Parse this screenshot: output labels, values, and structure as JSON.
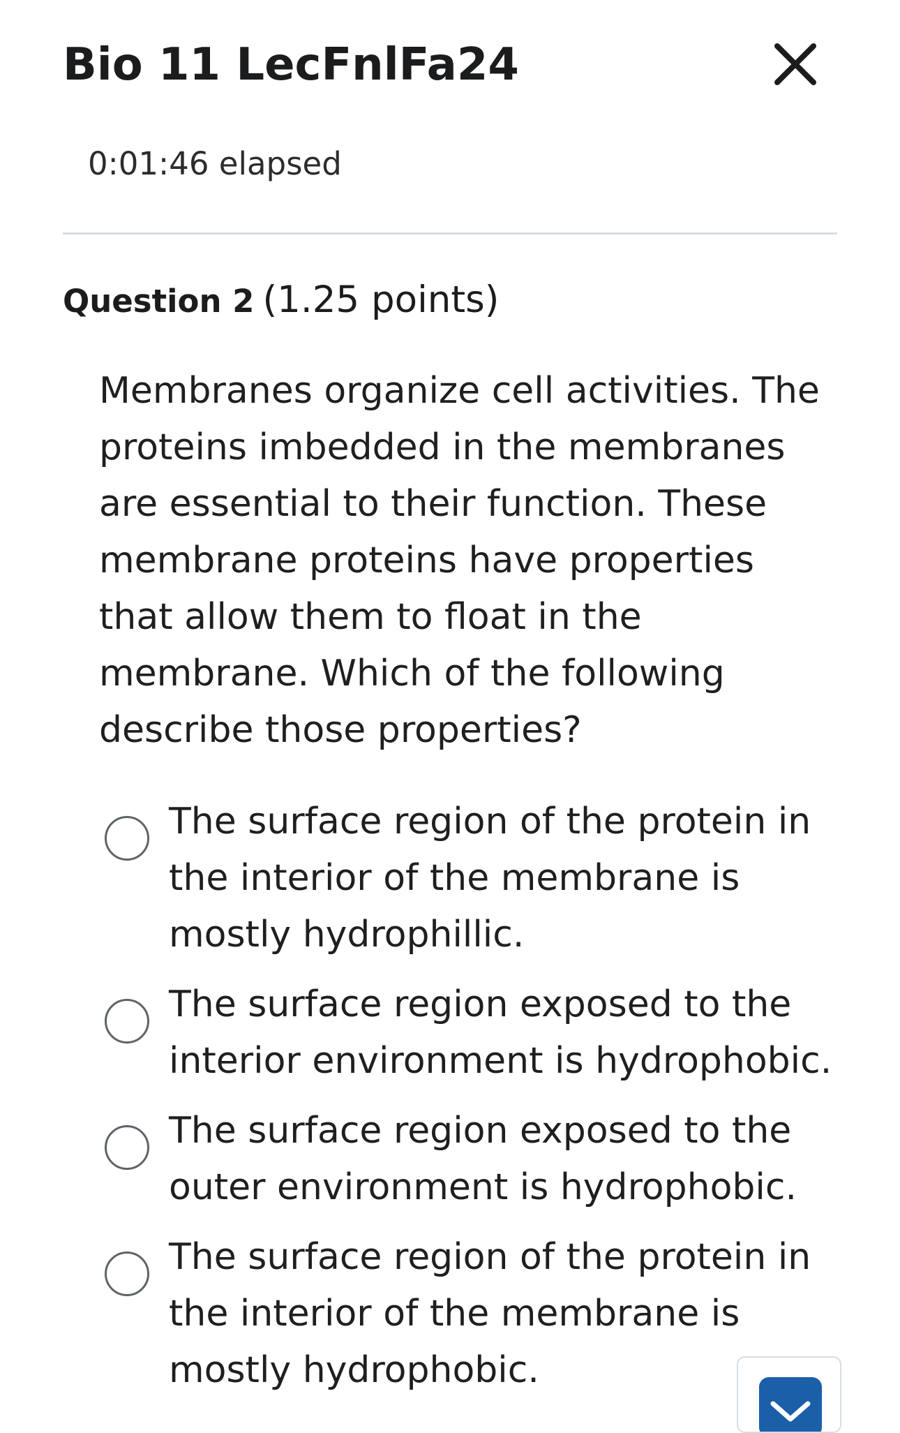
{
  "header": {
    "title": "Bio 11 LecFnlFa24",
    "close_icon": "close-icon"
  },
  "timer": {
    "text": "0:01:46 elapsed"
  },
  "question": {
    "label": "Question 2",
    "points": "(1.25 points)",
    "text": "Membranes organize cell activities. The proteins imbedded in the membranes are essential to their function. These membrane proteins have properties that allow them to float in the membrane. Which of the following describe those properties?",
    "options": [
      {
        "label": "The surface region of the protein in the interior of the membrane is mostly hydrophillic."
      },
      {
        "label": "The surface region exposed to the interior environment is hydrophobic."
      },
      {
        "label": "The surface region exposed to the outer environment is hydrophobic."
      },
      {
        "label": "The surface region of the protein in the interior of the membrane is mostly hydrophobic."
      }
    ]
  },
  "widget": {
    "icon": "message-tray-icon"
  },
  "colors": {
    "accent": "#1b5fa8",
    "divider": "#d6dde3",
    "radio_border": "#5f6368"
  }
}
